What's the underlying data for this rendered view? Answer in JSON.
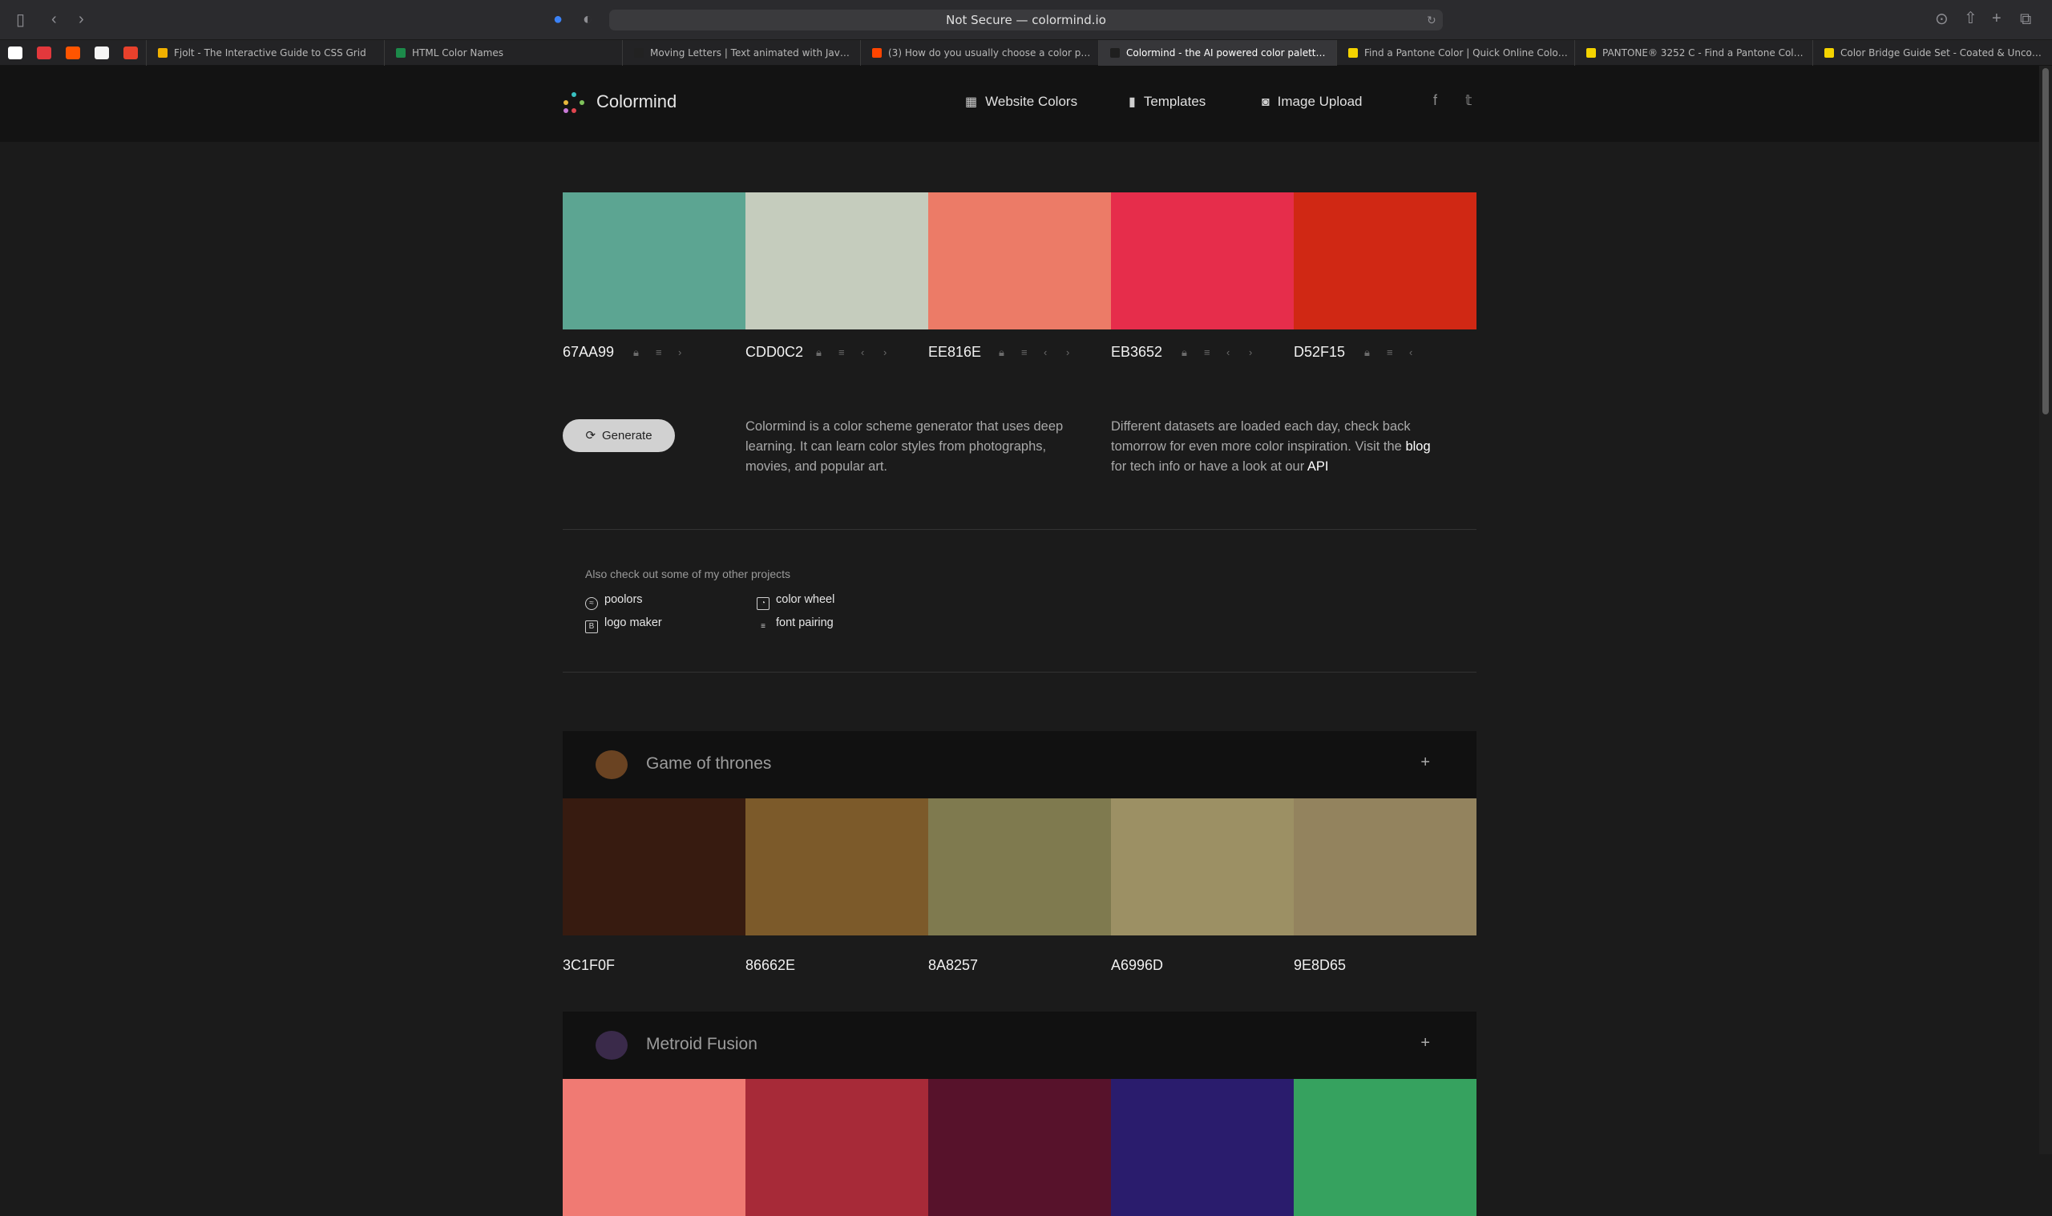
{
  "browser": {
    "address": "Not Secure — colormind.io",
    "tabs": [
      {
        "label": "Fjolt - The Interactive Guide to CSS Grid",
        "fav": "#f0b000",
        "active": false
      },
      {
        "label": "HTML Color Names",
        "fav": "#1c8a4a",
        "active": false
      },
      {
        "label": "Moving Letters | Text animated with JavaSc...",
        "fav": "#222222",
        "active": false
      },
      {
        "label": "(3) How do you usually choose a color pale...",
        "fav": "#ff4500",
        "active": false
      },
      {
        "label": "Colormind - the AI powered color palette g...",
        "fav": "#1f1f1f",
        "active": true
      },
      {
        "label": "Find a Pantone Color | Quick Online Color T...",
        "fav": "#f4d300",
        "active": false
      },
      {
        "label": "PANTONE® 3252 C - Find a Pantone Color...",
        "fav": "#f4d300",
        "active": false
      },
      {
        "label": "Color Bridge Guide Set - Coated & Uncoat...",
        "fav": "#f4d300",
        "active": false
      }
    ],
    "pinned": [
      "#ffffff",
      "#e2383c",
      "#ff5500",
      "#f5f5f5",
      "#e8412c"
    ]
  },
  "header": {
    "logo": "Colormind",
    "nav": [
      {
        "label": "Website Colors",
        "icon": "grid-icon"
      },
      {
        "label": "Templates",
        "icon": "bookmark-icon"
      },
      {
        "label": "Image Upload",
        "icon": "camera-icon"
      }
    ],
    "social": [
      "f",
      "𝕥"
    ]
  },
  "palette": [
    {
      "hex": "67AA99",
      "color": "#5ca592"
    },
    {
      "hex": "CDD0C2",
      "color": "#c5ccbd"
    },
    {
      "hex": "EE816E",
      "color": "#ec7b67"
    },
    {
      "hex": "EB3652",
      "color": "#e62d4b"
    },
    {
      "hex": "D52F15",
      "color": "#d02814"
    }
  ],
  "generate_label": "Generate",
  "intro": {
    "left": "Colormind is a color scheme generator that uses deep learning. It can learn color styles from photographs, movies, and popular art.",
    "right_pre": "Different datasets are loaded each day, check back tomorrow for even more color inspiration. Visit the ",
    "blog": "blog",
    "right_mid": " for tech info or have a look at our ",
    "api": "API"
  },
  "projects": {
    "title": "Also check out some of my other projects",
    "items": [
      "poolors",
      "color wheel",
      "logo maker",
      "font pairing"
    ]
  },
  "cards": [
    {
      "title": "Game of thrones",
      "plus": "+",
      "swatches": [
        {
          "hex": "3C1F0F",
          "color": "#371b10"
        },
        {
          "hex": "86662E",
          "color": "#7c5a2a"
        },
        {
          "hex": "8A8257",
          "color": "#7f7a4f"
        },
        {
          "hex": "A6996D",
          "color": "#9c9064"
        },
        {
          "hex": "9E8D65",
          "color": "#93835e"
        }
      ]
    },
    {
      "title": "Metroid Fusion",
      "plus": "+",
      "swatches": [
        {
          "hex": "",
          "color": "#f07a73"
        },
        {
          "hex": "",
          "color": "#a72a38"
        },
        {
          "hex": "",
          "color": "#57122b"
        },
        {
          "hex": "",
          "color": "#2a1c6d"
        },
        {
          "hex": "",
          "color": "#36a25f"
        }
      ]
    }
  ]
}
